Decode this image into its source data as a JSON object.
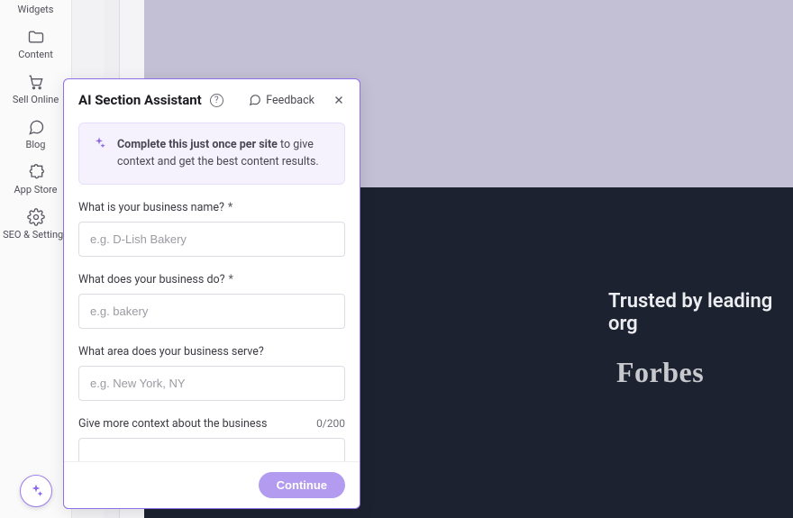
{
  "sidebar": {
    "items": [
      {
        "label": "Widgets"
      },
      {
        "label": "Content"
      },
      {
        "label": "Sell Online"
      },
      {
        "label": "Blog"
      },
      {
        "label": "App Store"
      },
      {
        "label": "SEO & Settings"
      }
    ]
  },
  "canvas": {
    "trusted_text": "Trusted by leading org",
    "logo1": "Forbes"
  },
  "modal": {
    "title": "AI Section Assistant",
    "feedback_label": "Feedback",
    "info_bold": "Complete this just once per site",
    "info_rest": " to give context and get the best content results.",
    "fields": {
      "business_name": {
        "label": "What is your business name?",
        "required": "*",
        "placeholder": "e.g. D-Lish Bakery"
      },
      "business_do": {
        "label": "What does your business do?",
        "required": "*",
        "placeholder": "e.g. bakery"
      },
      "business_area": {
        "label": "What area does your business serve?",
        "placeholder": "e.g. New York, NY"
      },
      "more_context": {
        "label": "Give more context about the business",
        "counter": "0/200"
      }
    },
    "continue_label": "Continue"
  }
}
